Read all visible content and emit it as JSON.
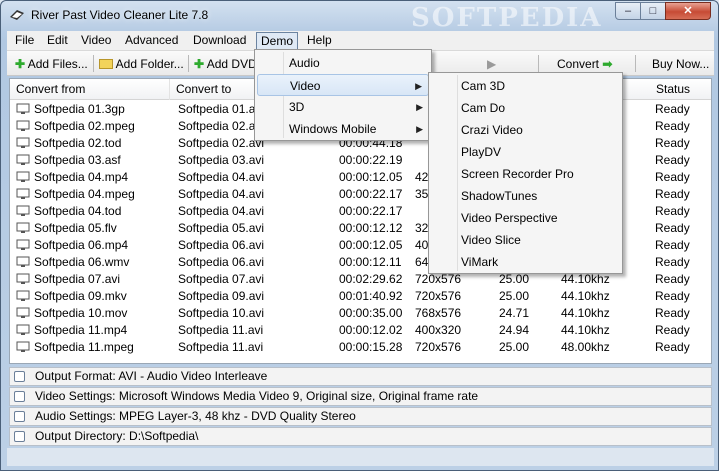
{
  "window": {
    "title": "River Past Video Cleaner Lite 7.8",
    "watermark": "SOFTPEDIA",
    "controls": {
      "minimize": "–",
      "maximize": "□",
      "close": "✕"
    }
  },
  "menubar": {
    "items": [
      "File",
      "Edit",
      "Video",
      "Advanced",
      "Download",
      "Demo",
      "Help"
    ]
  },
  "toolbar": {
    "add_files": "Add Files...",
    "add_folder": "Add Folder...",
    "add_dvd": "Add DVD...",
    "convert": "Convert",
    "buy_now": "Buy Now..."
  },
  "columns": {
    "convert_from": "Convert from",
    "convert_to": "Convert to",
    "status": "Status"
  },
  "files": [
    {
      "from": "Softpedia 01.3gp",
      "to": "Softpedia 01.avi",
      "duration": "",
      "size": "",
      "fps": "",
      "audio": "",
      "status": "Ready"
    },
    {
      "from": "Softpedia 02.mpeg",
      "to": "Softpedia 02.avi",
      "duration": "",
      "size": "",
      "fps": "",
      "audio": "",
      "status": "Ready"
    },
    {
      "from": "Softpedia 02.tod",
      "to": "Softpedia 02.avi",
      "duration": "00:00:44.18",
      "size": "",
      "fps": "",
      "audio": "",
      "status": "Ready"
    },
    {
      "from": "Softpedia 03.asf",
      "to": "Softpedia 03.avi",
      "duration": "00:00:22.19",
      "size": "",
      "fps": "",
      "audio": "",
      "status": "Ready"
    },
    {
      "from": "Softpedia 04.mp4",
      "to": "Softpedia 04.avi",
      "duration": "00:00:12.05",
      "size": "42",
      "fps": "",
      "audio": "",
      "status": "Ready"
    },
    {
      "from": "Softpedia 04.mpeg",
      "to": "Softpedia 04.avi",
      "duration": "00:00:22.17",
      "size": "35",
      "fps": "",
      "audio": "",
      "status": "Ready"
    },
    {
      "from": "Softpedia 04.tod",
      "to": "Softpedia 04.avi",
      "duration": "00:00:22.17",
      "size": "",
      "fps": "",
      "audio": "",
      "status": "Ready"
    },
    {
      "from": "Softpedia 05.flv",
      "to": "Softpedia 05.avi",
      "duration": "00:00:12.12",
      "size": "32",
      "fps": "",
      "audio": "",
      "status": "Ready"
    },
    {
      "from": "Softpedia 06.mp4",
      "to": "Softpedia 06.avi",
      "duration": "00:00:12.05",
      "size": "40",
      "fps": "",
      "audio": "",
      "status": "Ready"
    },
    {
      "from": "Softpedia 06.wmv",
      "to": "Softpedia 06.avi",
      "duration": "00:00:12.11",
      "size": "64",
      "fps": "",
      "audio": "",
      "status": "Ready"
    },
    {
      "from": "Softpedia 07.avi",
      "to": "Softpedia 07.avi",
      "duration": "00:02:29.62",
      "size": "720x576",
      "fps": "25.00",
      "audio": "44.10khz",
      "status": "Ready"
    },
    {
      "from": "Softpedia 09.mkv",
      "to": "Softpedia 09.avi",
      "duration": "00:01:40.92",
      "size": "720x576",
      "fps": "25.00",
      "audio": "44.10khz",
      "status": "Ready"
    },
    {
      "from": "Softpedia 10.mov",
      "to": "Softpedia 10.avi",
      "duration": "00:00:35.00",
      "size": "768x576",
      "fps": "24.71",
      "audio": "44.10khz",
      "status": "Ready"
    },
    {
      "from": "Softpedia 11.mp4",
      "to": "Softpedia 11.avi",
      "duration": "00:00:12.02",
      "size": "400x320",
      "fps": "24.94",
      "audio": "44.10khz",
      "status": "Ready"
    },
    {
      "from": "Softpedia 11.mpeg",
      "to": "Softpedia 11.avi",
      "duration": "00:00:15.28",
      "size": "720x576",
      "fps": "25.00",
      "audio": "48.00khz",
      "status": "Ready"
    }
  ],
  "panels": {
    "output_format": "Output Format: AVI - Audio Video Interleave",
    "video_settings": "Video Settings: Microsoft Windows Media Video 9, Original size, Original frame rate",
    "audio_settings": "Audio Settings: MPEG Layer-3, 48 khz - DVD Quality Stereo",
    "output_directory": "Output Directory: D:\\Softpedia\\"
  },
  "demo_menu": {
    "items": [
      "Audio",
      "Video",
      "3D",
      "Windows Mobile"
    ]
  },
  "video_submenu": {
    "items": [
      "Cam 3D",
      "Cam Do",
      "Crazi Video",
      "PlayDV",
      "Screen Recorder Pro",
      "ShadowTunes",
      "Video Perspective",
      "Video Slice",
      "ViMark"
    ]
  },
  "colors": {
    "convert_arrow": "#2eaa2e",
    "highlight_border": "#a8c4e5"
  }
}
